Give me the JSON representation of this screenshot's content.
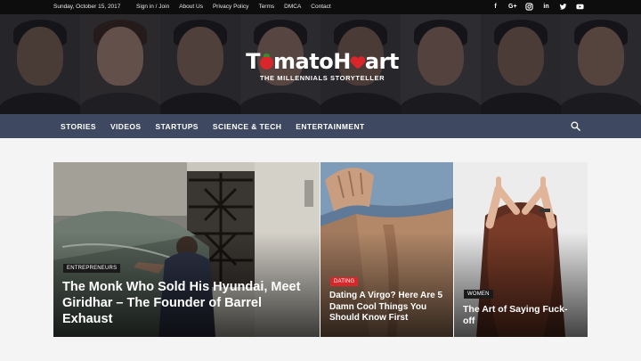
{
  "topbar": {
    "date": "Sunday, October 15, 2017",
    "links": [
      "Sign in / Join",
      "About Us",
      "Privacy Policy",
      "Terms",
      "DMCA",
      "Contact"
    ],
    "social_icons": [
      "facebook-icon",
      "google-plus-icon",
      "instagram-icon",
      "linkedin-icon",
      "twitter-icon",
      "youtube-icon"
    ]
  },
  "header": {
    "logo_part1": "T",
    "logo_part2": "mato",
    "logo_part3": "H",
    "logo_part4": "art",
    "tagline": "THE MILLENNIALS STORYTELLER"
  },
  "nav": {
    "items": [
      "STORIES",
      "VIDEOS",
      "STARTUPS",
      "SCIENCE & TECH",
      "ENTERTAINMENT"
    ],
    "search_icon": "search-icon"
  },
  "featured": [
    {
      "category": "ENTREPRENEURS",
      "title": "The Monk Who Sold His Hyundai, Meet Giridhar – The Founder of Barrel Exhaust",
      "category_color": "#1a1a1a"
    },
    {
      "category": "DATING",
      "title": "Dating A Virgo? Here Are 5 Damn Cool Things You Should Know First",
      "category_color": "#d9262b"
    },
    {
      "category": "WOMEN",
      "title": "The Art of Saying Fuck-off",
      "category_color": "#1a1a1a"
    }
  ],
  "colors": {
    "accent": "#d9262b",
    "nav_background": "#3e4860",
    "topbar_background": "#0d0d0d"
  }
}
